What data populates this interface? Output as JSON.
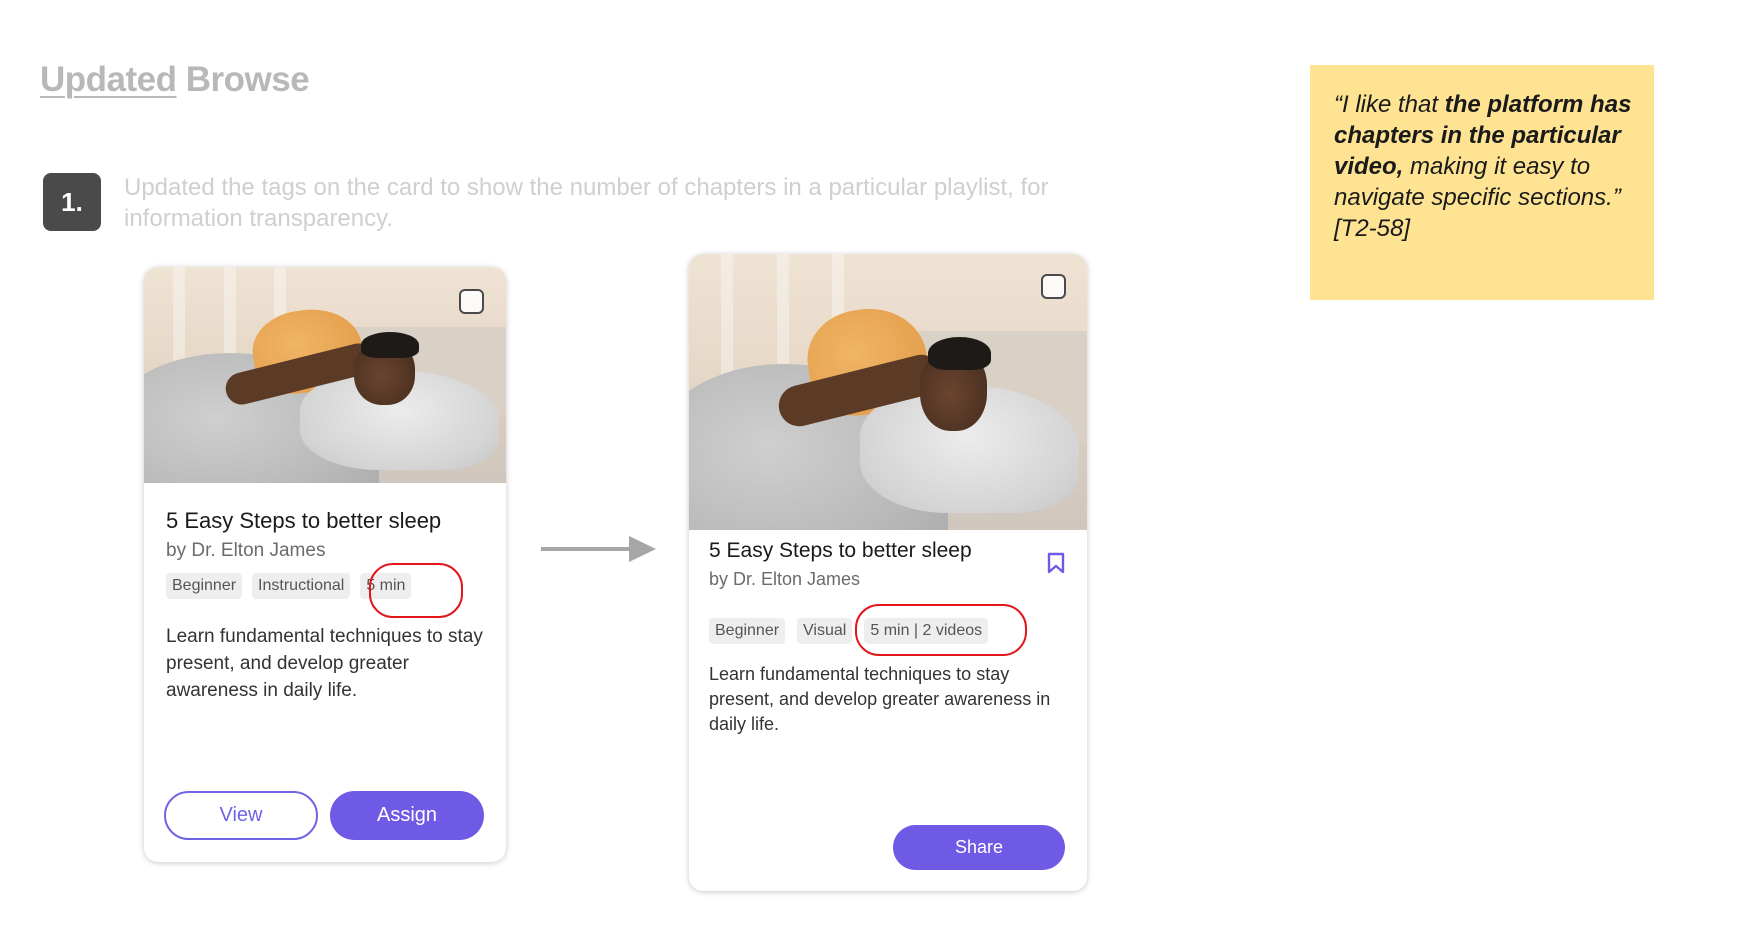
{
  "page": {
    "title_part1": "Updated",
    "title_part2": "Browse"
  },
  "step": {
    "number": "1.",
    "description": "Updated the tags on the card to show the number of chapters in a particular playlist, for information transparency."
  },
  "quote": {
    "open": "“I like that ",
    "bold": "the platform has chapters in the particular video,",
    "rest": " making it easy to navigate specific sections.”",
    "ref": "[T2-58]"
  },
  "card_old": {
    "title": "5 Easy Steps to better sleep",
    "author": "by Dr. Elton James",
    "tags": [
      "Beginner",
      "Instructional",
      "5 min"
    ],
    "description": "Learn fundamental techniques to stay present, and develop greater awareness in daily life.",
    "view_label": "View",
    "assign_label": "Assign"
  },
  "card_new": {
    "title": "5 Easy Steps to better sleep",
    "author": "by Dr. Elton James",
    "tags": [
      "Beginner",
      "Visual",
      "5 min | 2 videos"
    ],
    "description": "Learn fundamental techniques to stay present, and develop greater awareness in daily life.",
    "share_label": "Share"
  },
  "colors": {
    "accent": "#6f5ae6",
    "highlight": "#e2161b",
    "quote_bg": "#fde392",
    "muted_title": "#b8b8b8"
  },
  "icons": [
    "checkbox-icon",
    "bookmark-icon",
    "arrow-right-icon"
  ]
}
